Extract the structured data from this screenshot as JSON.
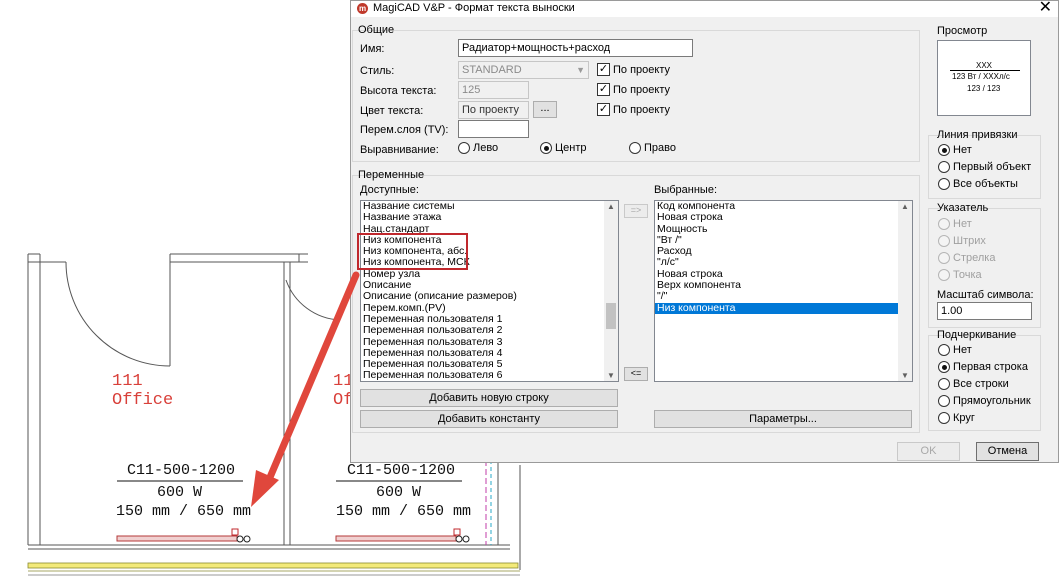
{
  "window": {
    "title": "MagiCAD V&P - Формат текста выноски",
    "close_icon": "✕"
  },
  "general": {
    "group_label": "Общие",
    "name_label": "Имя:",
    "name_value": "Радиатор+мощность+расход",
    "style_label": "Стиль:",
    "style_value": "STANDARD",
    "text_height_label": "Высота текста:",
    "text_height_value": "125",
    "text_color_label": "Цвет текста:",
    "text_color_value": "По проекту",
    "browse_label": "...",
    "layer_var_label": "Перем.слоя (TV):",
    "layer_var_value": "",
    "by_project_label": "По проекту",
    "alignment_label": "Выравнивание:",
    "align_left": "Лево",
    "align_center": "Центр",
    "align_right": "Право",
    "selected_alignment": "center"
  },
  "variables": {
    "group_label": "Переменные",
    "available_label": "Доступные:",
    "available": [
      "Название системы",
      "Название этажа",
      "Нац.стандарт",
      "Низ компонента",
      "Низ компонента, абс.",
      "Низ компонента, МСК",
      "Номер узла",
      "Описание",
      "Описание (описание размеров)",
      "Перем.комп.(PV)",
      "Переменная пользователя 1",
      "Переменная пользователя 2",
      "Переменная пользователя 3",
      "Переменная пользователя 4",
      "Переменная пользователя 5",
      "Переменная пользователя 6"
    ],
    "selected_label": "Выбранные:",
    "selected": [
      "Код компонента",
      "Новая строка",
      "Мощность",
      "\"Вт /\"",
      "Расход",
      "\"л/с\"",
      "Новая строка",
      "Верх компонента",
      "\"/\"",
      "Низ компонента"
    ],
    "selected_index": 9,
    "move_right_label": "=>",
    "move_left_label": "<=",
    "add_line_button": "Добавить новую строку",
    "add_constant_button": "Добавить константу",
    "params_button": "Параметры..."
  },
  "preview": {
    "label": "Просмотр",
    "line1": "XXX",
    "line2": "123 Вт /    XXXл/с",
    "line3": "123 / 123"
  },
  "anchor_line": {
    "label": "Линия привязки",
    "options": [
      "Нет",
      "Первый объект",
      "Все объекты"
    ],
    "selected": 0
  },
  "pointer": {
    "label": "Указатель",
    "options": [
      "Нет",
      "Штрих",
      "Стрелка",
      "Точка"
    ],
    "scale_label": "Масштаб символа:",
    "scale_value": "1.00"
  },
  "underline": {
    "label": "Подчеркивание",
    "options": [
      "Нет",
      "Первая строка",
      "Все строки",
      "Прямоугольник",
      "Круг"
    ],
    "selected": 1
  },
  "footer": {
    "ok": "OK",
    "cancel": "Отмена"
  },
  "drawing": {
    "room1_number": "111",
    "room1_name": "Office",
    "room2_number": "11",
    "room2_name": "Of",
    "tag_code": "C11-500-1200",
    "tag_power": "600 W",
    "tag_size": "150 mm / 650 mm"
  },
  "colors": {
    "highlight": "#c0282d",
    "arrow": "#e0473c",
    "selection": "#0078d7",
    "room_text": "#d9403a"
  }
}
